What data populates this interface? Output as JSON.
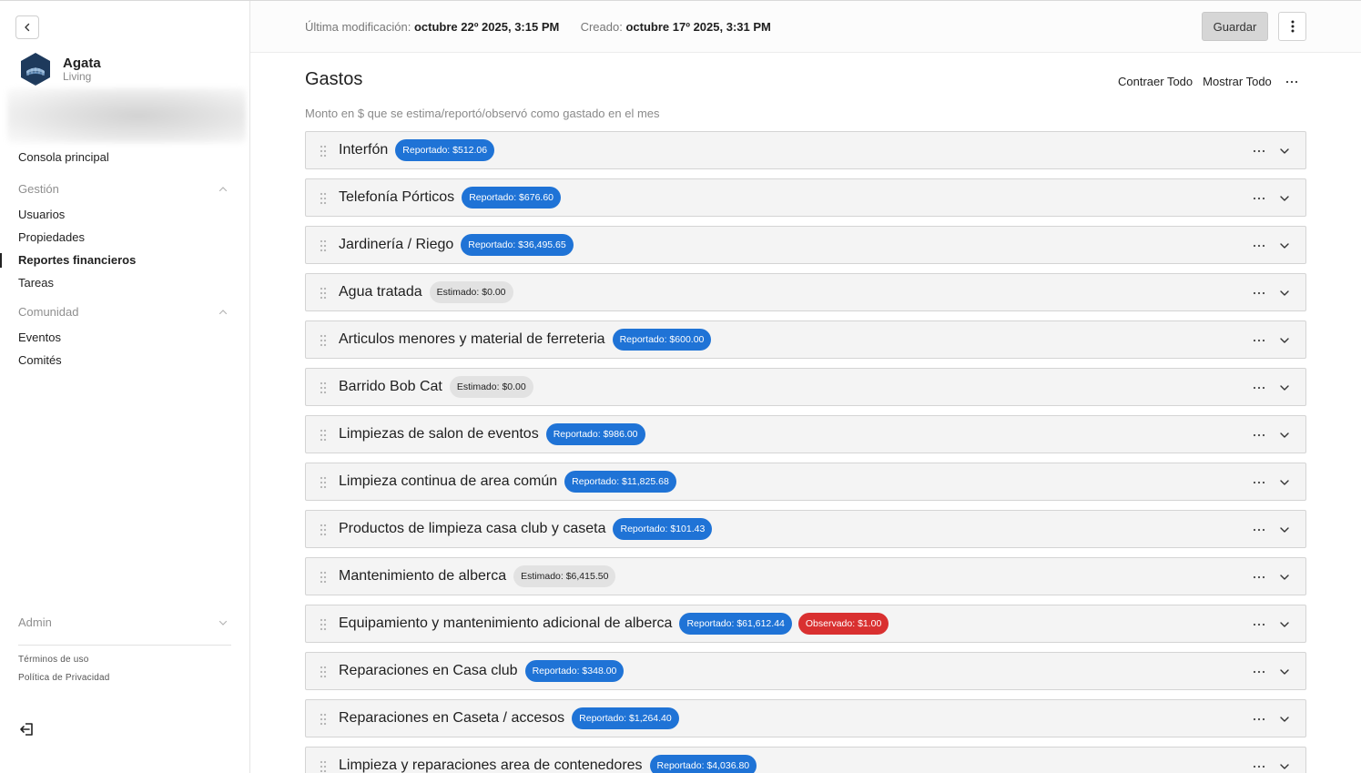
{
  "sidebar": {
    "brand": {
      "name": "Agata",
      "subtitle": "Living"
    },
    "home": "Consola principal",
    "sections": [
      {
        "label": "Gestión",
        "items": [
          "Usuarios",
          "Propiedades",
          "Reportes financieros",
          "Tareas"
        ]
      },
      {
        "label": "Comunidad",
        "items": [
          "Eventos",
          "Comités"
        ]
      }
    ],
    "admin": "Admin",
    "legal": {
      "terms": "Términos de uso",
      "privacy": "Política de Privacidad"
    },
    "active_item": "Reportes financieros"
  },
  "header": {
    "modified_label": "Última modificación:",
    "modified_value": "octubre 22º 2025, 3:15 PM",
    "created_label": "Creado:",
    "created_value": "octubre 17º 2025, 3:31 PM",
    "save_label": "Guardar"
  },
  "page": {
    "title": "Gastos",
    "collapse_all": "Contraer Todo",
    "expand_all": "Mostrar Todo",
    "subtitle": "Monto en $ que se estima/reportó/observó como gastado en el mes"
  },
  "expenses": [
    {
      "name": "Interfón",
      "badges": [
        {
          "type": "reportado",
          "text": "Reportado: $512.06"
        }
      ]
    },
    {
      "name": "Telefonía Pórticos",
      "badges": [
        {
          "type": "reportado",
          "text": "Reportado: $676.60"
        }
      ]
    },
    {
      "name": "Jardinería / Riego",
      "badges": [
        {
          "type": "reportado",
          "text": "Reportado: $36,495.65"
        }
      ]
    },
    {
      "name": "Agua tratada",
      "badges": [
        {
          "type": "estimado",
          "text": "Estimado: $0.00"
        }
      ]
    },
    {
      "name": "Articulos menores y material de ferreteria",
      "badges": [
        {
          "type": "reportado",
          "text": "Reportado: $600.00"
        }
      ]
    },
    {
      "name": "Barrido Bob Cat",
      "badges": [
        {
          "type": "estimado",
          "text": "Estimado: $0.00"
        }
      ]
    },
    {
      "name": "Limpiezas de salon de eventos",
      "badges": [
        {
          "type": "reportado",
          "text": "Reportado: $986.00"
        }
      ]
    },
    {
      "name": "Limpieza continua de area común",
      "badges": [
        {
          "type": "reportado",
          "text": "Reportado: $11,825.68"
        }
      ]
    },
    {
      "name": "Productos de limpieza casa club y caseta",
      "badges": [
        {
          "type": "reportado",
          "text": "Reportado: $101.43"
        }
      ]
    },
    {
      "name": "Mantenimiento de alberca",
      "badges": [
        {
          "type": "estimado",
          "text": "Estimado: $6,415.50"
        }
      ]
    },
    {
      "name": "Equipamiento y mantenimiento adicional de alberca",
      "badges": [
        {
          "type": "reportado",
          "text": "Reportado: $61,612.44"
        },
        {
          "type": "observado",
          "text": "Observado: $1.00"
        }
      ]
    },
    {
      "name": "Reparaciones en Casa club",
      "badges": [
        {
          "type": "reportado",
          "text": "Reportado: $348.00"
        }
      ]
    },
    {
      "name": "Reparaciones en Caseta / accesos",
      "badges": [
        {
          "type": "reportado",
          "text": "Reportado: $1,264.40"
        }
      ]
    },
    {
      "name": "Limpieza y reparaciones area de contenedores",
      "badges": [
        {
          "type": "reportado",
          "text": "Reportado: $4,036.80"
        }
      ]
    }
  ],
  "colors": {
    "reportado": "#1f73d6",
    "estimado": "#e2e2e2",
    "observado": "#d93030"
  }
}
